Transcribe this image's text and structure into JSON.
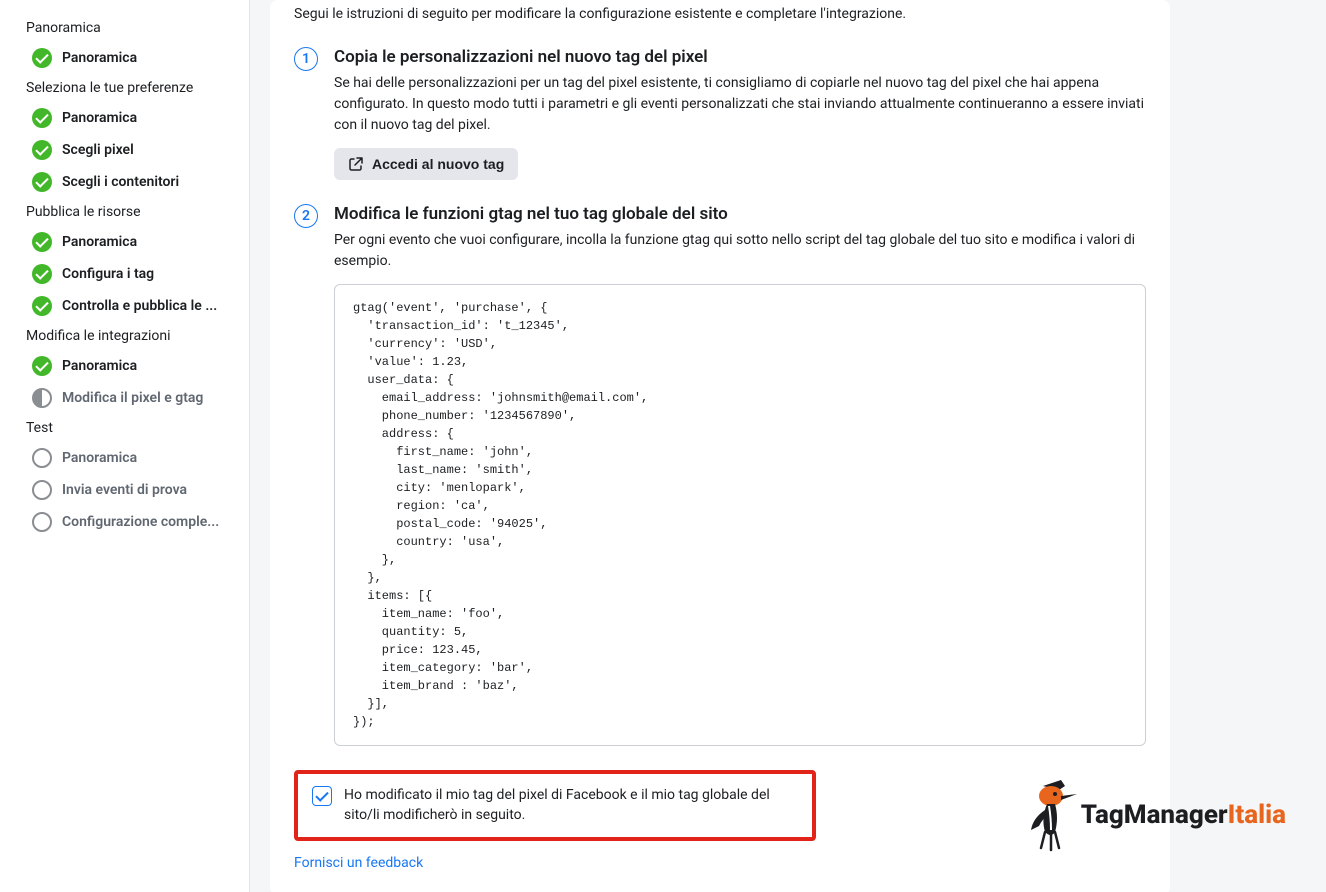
{
  "sidebar": {
    "sections": [
      {
        "header": "Panoramica",
        "items": [
          {
            "label": "Panoramica",
            "state": "check"
          }
        ]
      },
      {
        "header": "Seleziona le tue preferenze",
        "items": [
          {
            "label": "Panoramica",
            "state": "check"
          },
          {
            "label": "Scegli pixel",
            "state": "check"
          },
          {
            "label": "Scegli i contenitori",
            "state": "check"
          }
        ]
      },
      {
        "header": "Pubblica le risorse",
        "items": [
          {
            "label": "Panoramica",
            "state": "check"
          },
          {
            "label": "Configura i tag",
            "state": "check"
          },
          {
            "label": "Controlla e pubblica le ...",
            "state": "check"
          }
        ]
      },
      {
        "header": "Modifica le integrazioni",
        "items": [
          {
            "label": "Panoramica",
            "state": "check"
          },
          {
            "label": "Modifica il pixel e gtag",
            "state": "half"
          }
        ]
      },
      {
        "header": "Test",
        "items": [
          {
            "label": "Panoramica",
            "state": "empty"
          },
          {
            "label": "Invia eventi di prova",
            "state": "empty"
          },
          {
            "label": "Configurazione comple...",
            "state": "empty"
          }
        ]
      }
    ]
  },
  "main": {
    "intro": "Segui le istruzioni di seguito per modificare la configurazione esistente e completare l'integrazione.",
    "step1": {
      "title": "Copia le personalizzazioni nel nuovo tag del pixel",
      "desc": "Se hai delle personalizzazioni per un tag del pixel esistente, ti consigliamo di copiarle nel nuovo tag del pixel che hai appena configurato. In questo modo tutti i parametri e gli eventi personalizzati che stai inviando attualmente continueranno a essere inviati con il nuovo tag del pixel.",
      "button": "Accedi al nuovo tag"
    },
    "step2": {
      "title": "Modifica le funzioni gtag nel tuo tag globale del sito",
      "desc": "Per ogni evento che vuoi configurare, incolla la funzione gtag qui sotto nello script del tag globale del tuo sito e modifica i valori di esempio.",
      "code": "gtag('event', 'purchase', {\n  'transaction_id': 't_12345',\n  'currency': 'USD',\n  'value': 1.23,\n  user_data: {\n    email_address: 'johnsmith@email.com',\n    phone_number: '1234567890',\n    address: {\n      first_name: 'john',\n      last_name: 'smith',\n      city: 'menlopark',\n      region: 'ca',\n      postal_code: '94025',\n      country: 'usa',\n    },\n  },\n  items: [{\n    item_name: 'foo',\n    quantity: 5,\n    price: 123.45,\n    item_category: 'bar',\n    item_brand : 'baz',\n  }],\n});"
    },
    "confirm": "Ho modificato il mio tag del pixel di Facebook e il mio tag globale del sito/li modificherò in seguito.",
    "feedback": "Fornisci un feedback"
  },
  "logo": {
    "part1": "TagManager",
    "part2": "Italia"
  }
}
